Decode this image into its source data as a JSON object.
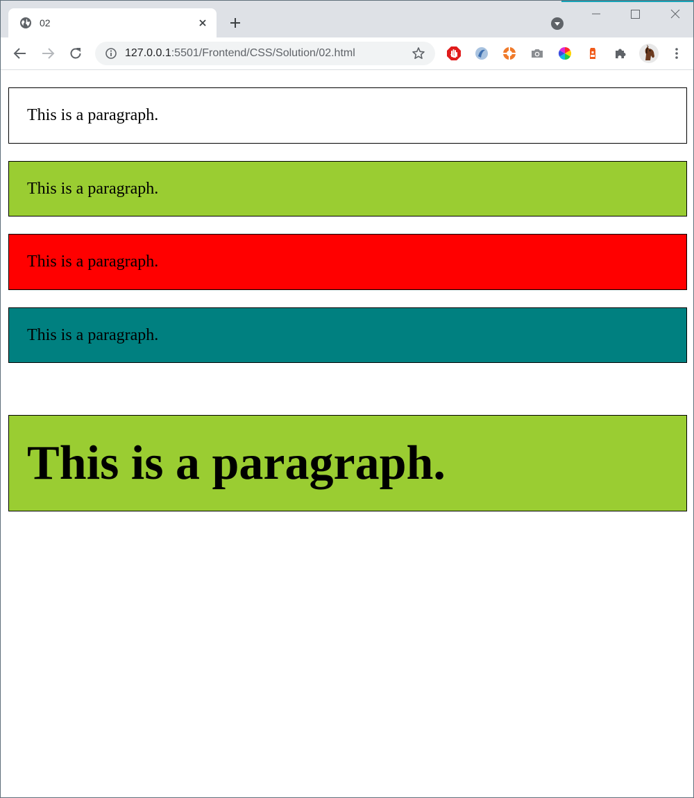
{
  "browser": {
    "accent_color": "#17a3b8",
    "tab": {
      "title": "02",
      "favicon": "globe-icon",
      "close": "close-icon"
    },
    "tab_strip": {
      "new_tab": "plus-icon",
      "tab_search": "chevron-down-circle-icon"
    },
    "window_controls": [
      "minimize-icon",
      "maximize-icon",
      "close-icon"
    ],
    "toolbar": {
      "back": "arrow-left-icon",
      "forward": "arrow-right-icon",
      "reload": "reload-icon",
      "site_info": "info-icon",
      "url_host": "127.0.0.1",
      "url_rest": ":5501/Frontend/CSS/Solution/02.html",
      "bookmark": "star-icon",
      "extensions": [
        "adblock-stop-icon",
        "blue-swirl-extension-icon",
        "orange-lifebuoy-extension-icon",
        "camera-icon",
        "color-wheel-icon",
        "orange-extension-icon",
        "puzzle-piece-icon"
      ],
      "profile": "horse-avatar-icon",
      "menu": "kebab-menu-icon"
    }
  },
  "page": {
    "paragraphs": [
      {
        "text": "This is a paragraph.",
        "background": "#ffffff"
      },
      {
        "text": "This is a paragraph.",
        "background": "#9acd32"
      },
      {
        "text": "This is a paragraph.",
        "background": "#ff0000"
      },
      {
        "text": "This is a paragraph.",
        "background": "#008080"
      },
      {
        "text": "This is a paragraph.",
        "background": "#9acd32"
      }
    ]
  }
}
